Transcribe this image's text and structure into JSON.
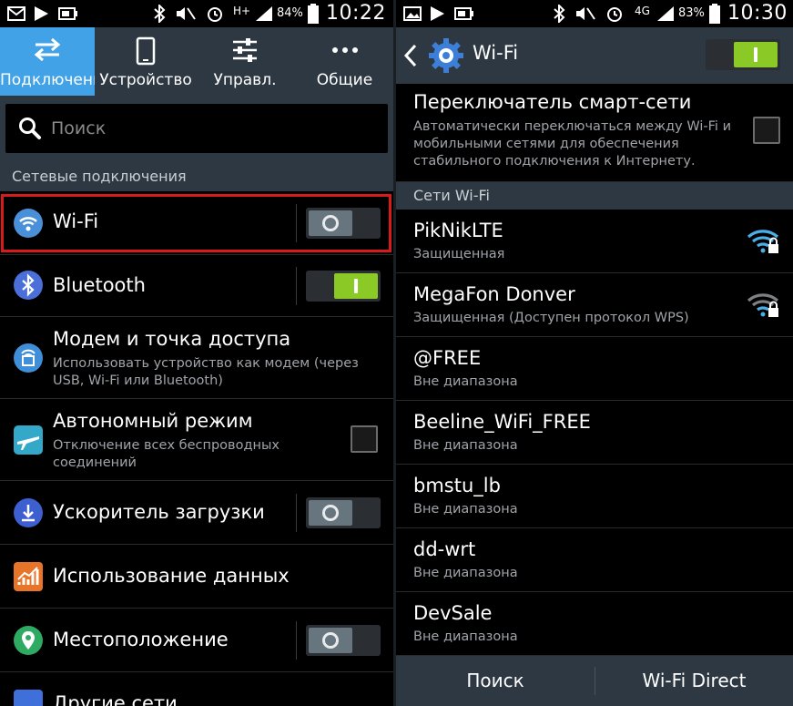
{
  "left": {
    "status": {
      "time": "10:22",
      "battery": "84%",
      "network": "H+"
    },
    "tabs": [
      {
        "label": "Подключени",
        "icon": "swap-arrows-icon",
        "active": true
      },
      {
        "label": "Устройство",
        "icon": "phone-icon"
      },
      {
        "label": "Управл.",
        "icon": "sliders-icon"
      },
      {
        "label": "Общие",
        "icon": "more-dots-icon"
      }
    ],
    "search": {
      "placeholder": "Поиск"
    },
    "section_header": "Сетевые подключения",
    "items": [
      {
        "title": "Wi-Fi",
        "icon": "wifi-icon",
        "control": "toggle",
        "state": "off",
        "highlighted": true
      },
      {
        "title": "Bluetooth",
        "icon": "bluetooth-icon",
        "control": "toggle",
        "state": "on"
      },
      {
        "title": "Модем и точка доступа",
        "subtitle": "Использовать устройство как модем (через USB, Wi-Fi или Bluetooth)",
        "icon": "hotspot-icon"
      },
      {
        "title": "Автономный режим",
        "subtitle": "Отключение всех беспроводных соединений",
        "icon": "airplane-icon",
        "control": "checkbox",
        "state": "unchecked"
      },
      {
        "title": "Ускоритель загрузки",
        "icon": "download-booster-icon",
        "control": "toggle",
        "state": "off"
      },
      {
        "title": "Использование данных",
        "icon": "data-usage-icon"
      },
      {
        "title": "Местоположение",
        "icon": "location-icon",
        "control": "toggle",
        "state": "off"
      },
      {
        "title": "Другие сети",
        "icon": "more-networks-icon"
      }
    ]
  },
  "right": {
    "status": {
      "time": "10:30",
      "battery": "83%",
      "network": "4G"
    },
    "header": {
      "title": "Wi-Fi",
      "icon": "gear-icon",
      "toggle_state": "on"
    },
    "smart_switch": {
      "title": "Переключатель смарт-сети",
      "subtitle": "Автоматически переключаться между Wi-Fi и мобильными сетями для обеспечения стабильного подключения к Интернету.",
      "checked": false
    },
    "section_header": "Сети Wi-Fi",
    "networks": [
      {
        "name": "PikNikLTE",
        "status": "Защищенная",
        "signal": "wifi-lock-icon",
        "strong": true
      },
      {
        "name": "MegaFon Donver",
        "status": "Защищенная (Доступен протокол WPS)",
        "signal": "wifi-lock-icon",
        "strong": false
      },
      {
        "name": "@FREE",
        "status": "Вне диапазона"
      },
      {
        "name": "Beeline_WiFi_FREE",
        "status": "Вне диапазона"
      },
      {
        "name": "bmstu_lb",
        "status": "Вне диапазона"
      },
      {
        "name": "dd-wrt",
        "status": "Вне диапазона"
      },
      {
        "name": "DevSale",
        "status": "Вне диапазона"
      }
    ],
    "bottom": {
      "scan": "Поиск",
      "direct": "Wi-Fi Direct"
    }
  },
  "colors": {
    "accent": "#41a2e8",
    "toggle_on": "#8ac926",
    "highlight": "#d71a1a",
    "bar": "#2d3842"
  }
}
